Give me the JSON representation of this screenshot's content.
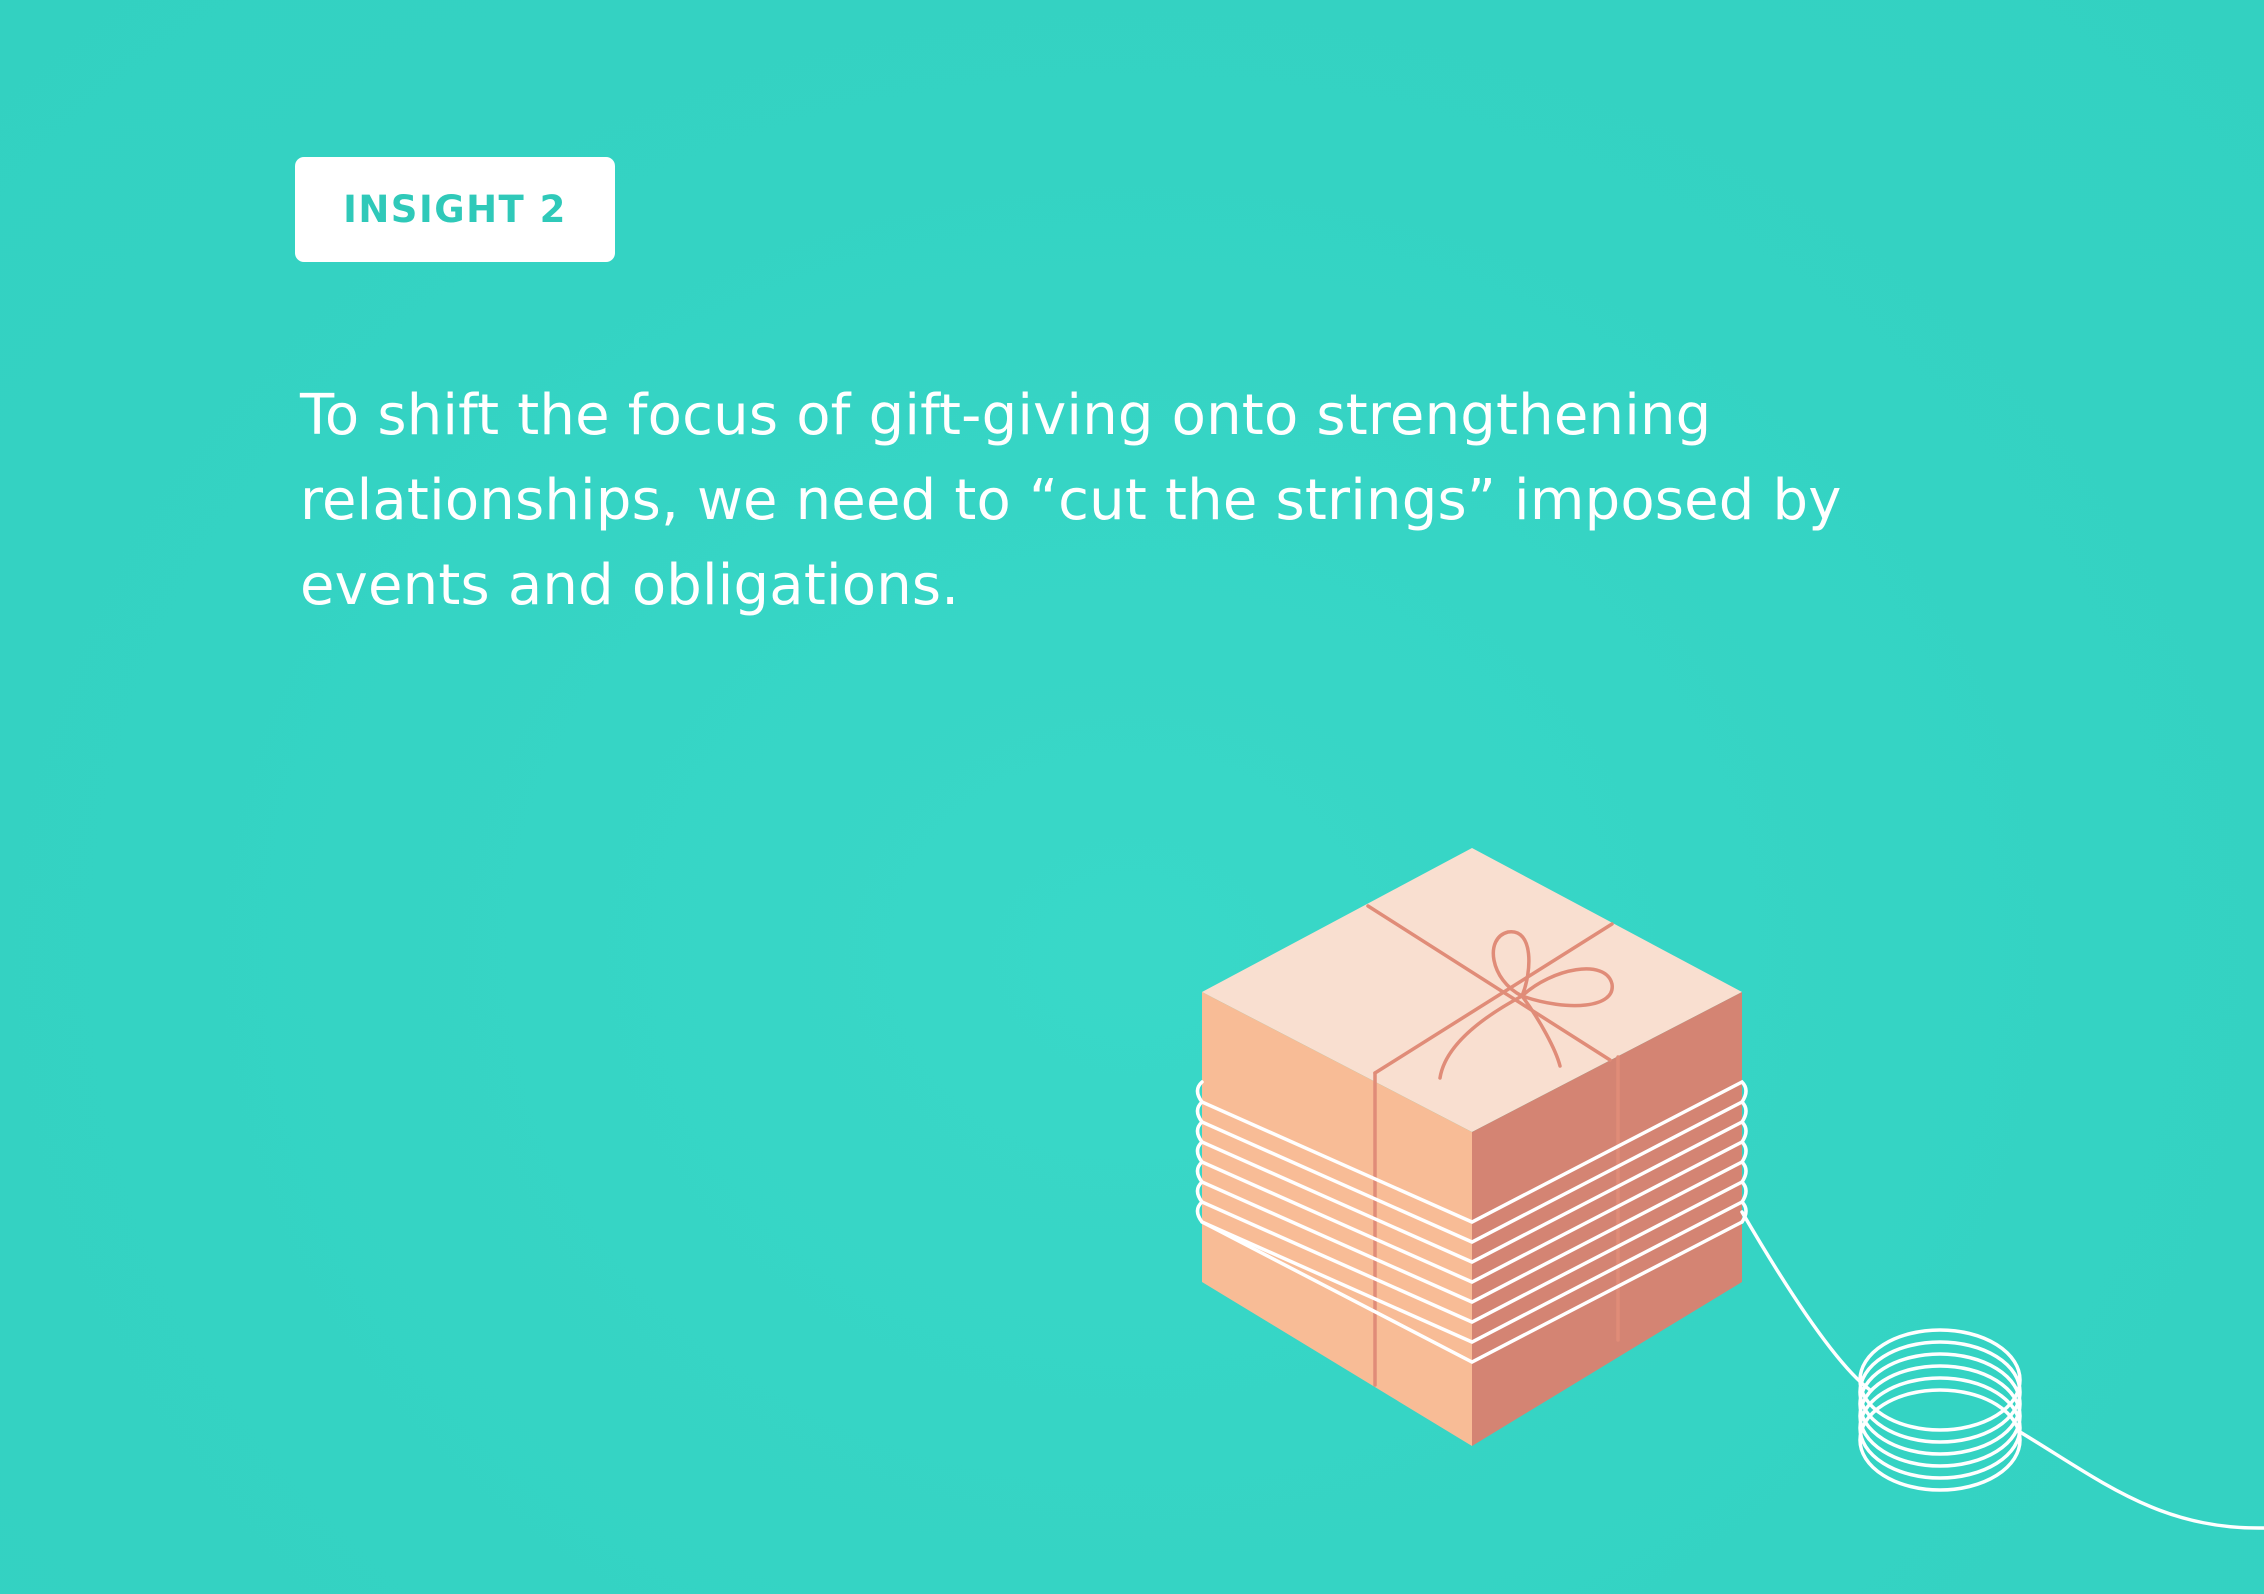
{
  "slide": {
    "badge_label": "INSIGHT 2",
    "headline": "To shift the focus of gift-giving onto strengthening relationships, we need to “cut the strings” imposed by events and obligations."
  },
  "illustration": {
    "subject": "gift-box-with-string-icon",
    "colors": {
      "background": "#36d4c4",
      "box_top": "#f9dfd0",
      "box_left": "#f8bc96",
      "box_right": "#d48473",
      "ribbon": "#e08c78",
      "string": "#ffffff"
    }
  }
}
